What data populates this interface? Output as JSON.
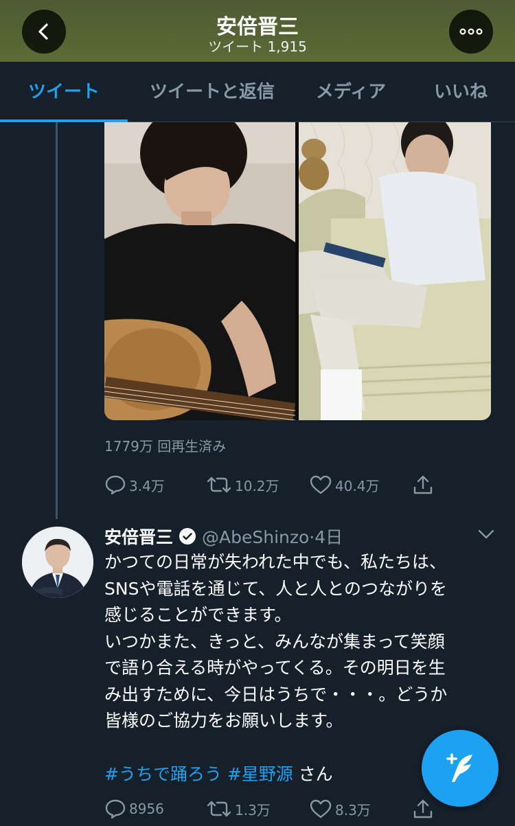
{
  "header": {
    "title": "安倍晋三",
    "subtitle": "ツイート 1,915"
  },
  "tabs": [
    {
      "label": "ツイート",
      "active": true
    },
    {
      "label": "ツイートと返信",
      "active": false
    },
    {
      "label": "メディア",
      "active": false
    },
    {
      "label": "いいね",
      "active": false
    }
  ],
  "first_tweet": {
    "views": "1779万 回再生済み",
    "replies": "3.4万",
    "retweets": "10.2万",
    "likes": "40.4万"
  },
  "second_tweet": {
    "name": "安倍晋三",
    "handle": "@AbeShinzo·4日",
    "lines": [
      "かつての日常が失われた中でも、私たちは、",
      "SNSや電話を通じて、人と人とのつながりを",
      "感じることができます。",
      "いつかまた、きっと、みんなが集まって笑顔",
      "で語り合える時がやってくる。その明日を生",
      "み出すために、今日はうちで・・・。どうか",
      "皆様のご協力をお願いします。"
    ],
    "hashtag1": "#うちで踊ろう",
    "hashtag2": "#星野源",
    "suffix": " さん",
    "replies": "8956",
    "retweets": "1.3万",
    "likes": "8.3万"
  },
  "colors": {
    "background": "#15202b",
    "accent": "#1da1f2",
    "muted": "#8899a6",
    "header": "#5b6b35"
  }
}
